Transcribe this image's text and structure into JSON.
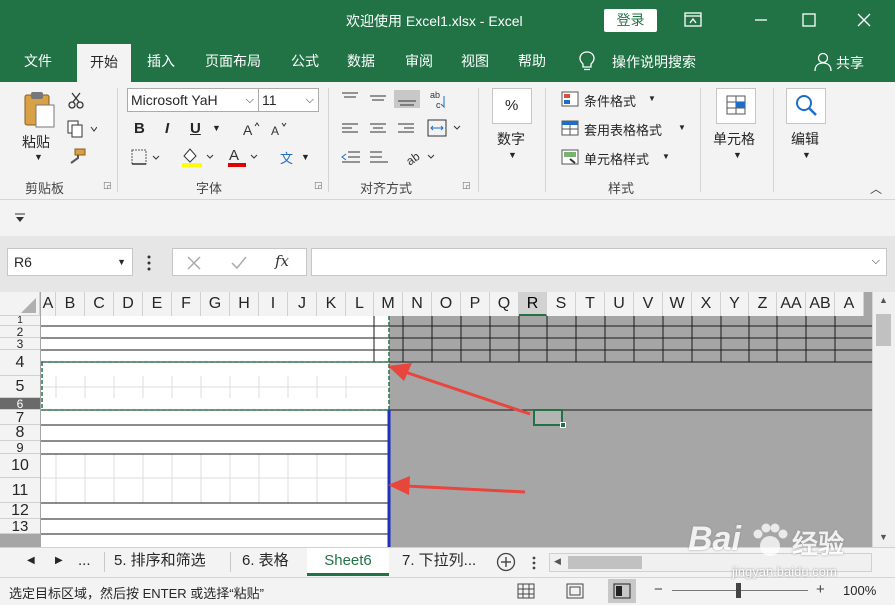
{
  "window": {
    "title": "欢迎使用 Excel1.xlsx  -  Excel",
    "login_label": "登录",
    "controls": [
      "restore-ribbon-icon",
      "minimize-icon",
      "maximize-icon",
      "close-icon"
    ]
  },
  "menu": {
    "tabs": [
      "文件",
      "开始",
      "插入",
      "页面布局",
      "公式",
      "数据",
      "审阅",
      "视图",
      "帮助"
    ],
    "active_tab": "开始",
    "tell_me": "操作说明搜索",
    "share": "共享"
  },
  "ribbon": {
    "clipboard": {
      "paste_label": "粘贴",
      "group_label": "剪贴板"
    },
    "font": {
      "font_name": "Microsoft YaH",
      "font_size": "11",
      "group_label": "字体",
      "bold": "B",
      "italic": "I",
      "underline": "U",
      "wen": "文"
    },
    "alignment": {
      "group_label": "对齐方式"
    },
    "number": {
      "label": "数字",
      "symbol": "%"
    },
    "styles": {
      "conditional": "条件格式",
      "table": "套用表格格式",
      "cell_styles": "单元格样式",
      "group_label": "样式"
    },
    "cells": {
      "label": "单元格"
    },
    "editing": {
      "label": "编辑"
    }
  },
  "formula_bar": {
    "name_box": "R6",
    "fx": "fx",
    "content": ""
  },
  "grid": {
    "columns": [
      "A",
      "B",
      "C",
      "D",
      "E",
      "F",
      "G",
      "H",
      "I",
      "J",
      "K",
      "L",
      "M",
      "N",
      "O",
      "P",
      "Q",
      "R",
      "S",
      "T",
      "U",
      "V",
      "W",
      "X",
      "Y",
      "Z",
      "AA",
      "AB",
      "A"
    ],
    "rows": [
      "1",
      "2",
      "3",
      "4",
      "5",
      "6",
      "7",
      "8",
      "9",
      "10",
      "11",
      "12",
      "13"
    ],
    "active_column": "R",
    "active_row": "6"
  },
  "sheets": {
    "ellipsis": "...",
    "tabs": [
      "5. 排序和筛选",
      "6. 表格",
      "Sheet6",
      "7. 下拉列..."
    ],
    "active": "Sheet6"
  },
  "status": {
    "message": "选定目标区域，然后按 ENTER 或选择“粘贴”",
    "zoom": "100%"
  },
  "watermark": {
    "brand": "Bai",
    "brand2": "经验",
    "url": "jingyan.baidu.com"
  },
  "colors": {
    "excel_green": "#217346",
    "arrow_red": "#e8453c",
    "page_border_blue": "#1f2fbf"
  }
}
